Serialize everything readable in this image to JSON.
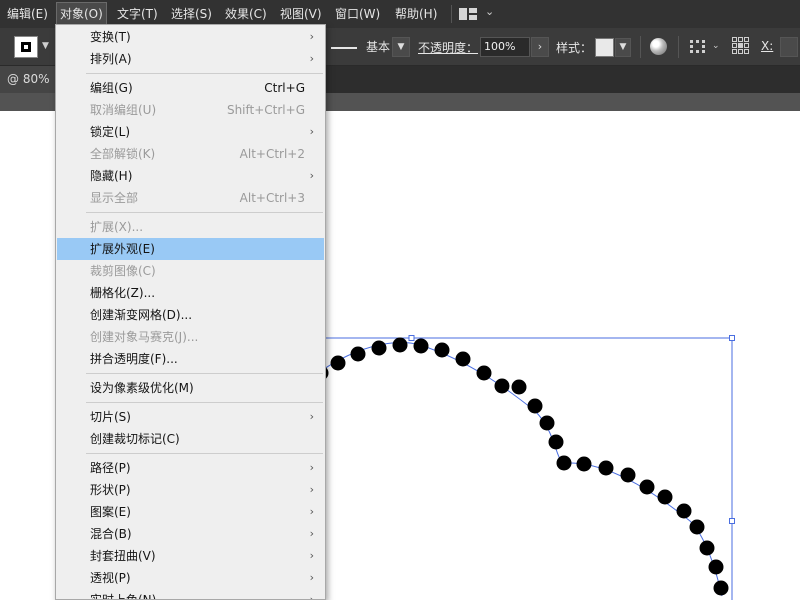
{
  "menubar": {
    "items": [
      "编辑(E)",
      "对象(O)",
      "文字(T)",
      "选择(S)",
      "效果(C)",
      "视图(V)",
      "窗口(W)",
      "帮助(H)"
    ]
  },
  "controlbar": {
    "stroke_style": "基本",
    "opacity_label": "不透明度：",
    "opacity_value": "100%",
    "style_label": "样式：",
    "x_label": "X:"
  },
  "document_tab": {
    "zoom": "@ 80%"
  },
  "menu": {
    "items": [
      {
        "label": "变换(T)",
        "shortcut": "",
        "submenu": true,
        "disabled": false,
        "highlighted": false
      },
      {
        "label": "排列(A)",
        "shortcut": "",
        "submenu": true,
        "disabled": false,
        "highlighted": false
      },
      {
        "label": "编组(G)",
        "shortcut": "Ctrl+G",
        "submenu": false,
        "disabled": false,
        "highlighted": false
      },
      {
        "label": "取消编组(U)",
        "shortcut": "Shift+Ctrl+G",
        "submenu": false,
        "disabled": true,
        "highlighted": false
      },
      {
        "label": "锁定(L)",
        "shortcut": "",
        "submenu": true,
        "disabled": false,
        "highlighted": false
      },
      {
        "label": "全部解锁(K)",
        "shortcut": "Alt+Ctrl+2",
        "submenu": false,
        "disabled": true,
        "highlighted": false
      },
      {
        "label": "隐藏(H)",
        "shortcut": "",
        "submenu": true,
        "disabled": false,
        "highlighted": false
      },
      {
        "label": "显示全部",
        "shortcut": "Alt+Ctrl+3",
        "submenu": false,
        "disabled": true,
        "highlighted": false
      },
      {
        "label": "扩展(X)...",
        "shortcut": "",
        "submenu": false,
        "disabled": true,
        "highlighted": false
      },
      {
        "label": "扩展外观(E)",
        "shortcut": "",
        "submenu": false,
        "disabled": false,
        "highlighted": true
      },
      {
        "label": "裁剪图像(C)",
        "shortcut": "",
        "submenu": false,
        "disabled": true,
        "highlighted": false
      },
      {
        "label": "栅格化(Z)...",
        "shortcut": "",
        "submenu": false,
        "disabled": false,
        "highlighted": false
      },
      {
        "label": "创建渐变网格(D)...",
        "shortcut": "",
        "submenu": false,
        "disabled": false,
        "highlighted": false
      },
      {
        "label": "创建对象马赛克(J)...",
        "shortcut": "",
        "submenu": false,
        "disabled": true,
        "highlighted": false
      },
      {
        "label": "拼合透明度(F)...",
        "shortcut": "",
        "submenu": false,
        "disabled": false,
        "highlighted": false
      },
      {
        "label": "设为像素级优化(M)",
        "shortcut": "",
        "submenu": false,
        "disabled": false,
        "highlighted": false
      },
      {
        "label": "切片(S)",
        "shortcut": "",
        "submenu": true,
        "disabled": false,
        "highlighted": false
      },
      {
        "label": "创建裁切标记(C)",
        "shortcut": "",
        "submenu": false,
        "disabled": false,
        "highlighted": false
      },
      {
        "label": "路径(P)",
        "shortcut": "",
        "submenu": true,
        "disabled": false,
        "highlighted": false
      },
      {
        "label": "形状(P)",
        "shortcut": "",
        "submenu": true,
        "disabled": false,
        "highlighted": false
      },
      {
        "label": "图案(E)",
        "shortcut": "",
        "submenu": true,
        "disabled": false,
        "highlighted": false
      },
      {
        "label": "混合(B)",
        "shortcut": "",
        "submenu": true,
        "disabled": false,
        "highlighted": false
      },
      {
        "label": "封套扭曲(V)",
        "shortcut": "",
        "submenu": true,
        "disabled": false,
        "highlighted": false
      },
      {
        "label": "透视(P)",
        "shortcut": "",
        "submenu": true,
        "disabled": false,
        "highlighted": false
      },
      {
        "label": "实时上色(N)",
        "shortcut": "",
        "submenu": true,
        "disabled": false,
        "highlighted": false
      }
    ]
  },
  "colors": {
    "menubar_bg": "#323232",
    "highlight": "#99c9f5",
    "selection_bbox": "#4a6ee0",
    "dot_fill": "#000000"
  }
}
